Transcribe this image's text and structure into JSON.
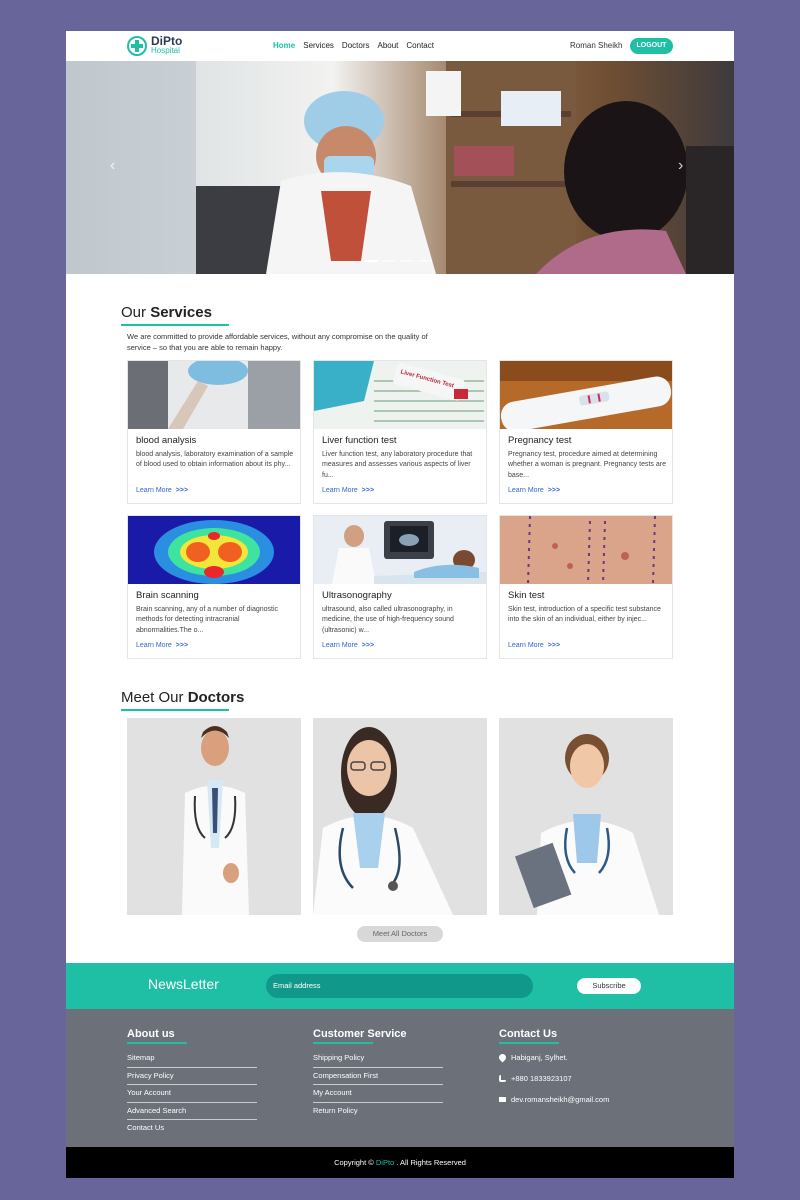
{
  "nav": {
    "logo_name": "DiPto",
    "logo_sub": "Hospital",
    "menu": [
      "Home",
      "Services",
      "Doctors",
      "About",
      "Contact"
    ],
    "user_name": "Roman Sheikh",
    "logout": "LOGOUT"
  },
  "services": {
    "title_a": "Our ",
    "title_b": "Services",
    "description": "We are committed to provide affordable services, without any compromise on the quality of service – so that you are able to remain happy.",
    "cards": [
      {
        "title": "blood analysis",
        "text": "blood analysis, laboratory examination of a sample of blood used to obtain information about its phy...",
        "more": "Learn More",
        "arrows": ">>>"
      },
      {
        "title": "Liver function test",
        "text": "Liver function test, any laboratory procedure that measures and assesses various aspects of liver fu...",
        "more": "Learn More",
        "arrows": ">>>",
        "img_label": "Liver Function Test"
      },
      {
        "title": "Pregnancy test",
        "text": "Pregnancy test, procedure aimed at determining whether a woman is pregnant. Pregnancy tests are base...",
        "more": "Learn More",
        "arrows": ">>>"
      },
      {
        "title": "Brain scanning",
        "text": "Brain scanning, any of a number of diagnostic methods for detecting intracranial abnormalities.The o...",
        "more": "Learn More",
        "arrows": ">>>"
      },
      {
        "title": "Ultrasonography",
        "text": "ultrasound, also called ultrasonography, in medicine, the use of high-frequency sound (ultrasonic) w...",
        "more": "Learn More",
        "arrows": ">>>"
      },
      {
        "title": "Skin test",
        "text": "Skin test, introduction of a specific test substance into the skin of an individual, either by injec...",
        "more": "Learn More",
        "arrows": ">>>"
      }
    ]
  },
  "doctors": {
    "title_a": "Meet Our ",
    "title_b": "Doctors",
    "button": "Meet All Doctors"
  },
  "newsletter": {
    "title": "NewsLetter",
    "placeholder": "Email address",
    "button": "Subscribe"
  },
  "footer": {
    "about": {
      "title": "About us",
      "links": [
        "Sitemap",
        "Privacy Policy",
        "Your Account",
        "Advanced Search",
        "Contact Us"
      ]
    },
    "service": {
      "title": "Customer Service",
      "links": [
        "Shipping Policy",
        "Compensation First",
        "My Account",
        "Return Policy"
      ]
    },
    "contact": {
      "title": "Contact Us",
      "address": "Habiganj, Sylhet.",
      "phone": "+880 1833923107",
      "email": "dev.romansheikh@gmail.com"
    }
  },
  "copyright": {
    "prefix": "Copyright © ",
    "brand": "DiPto",
    "suffix": " . All Rights Reserved"
  },
  "colors": {
    "accent": "#1ebfa5",
    "page_bg": "#68659a",
    "footer_bg": "#6b7079",
    "link": "#2f66c8"
  }
}
